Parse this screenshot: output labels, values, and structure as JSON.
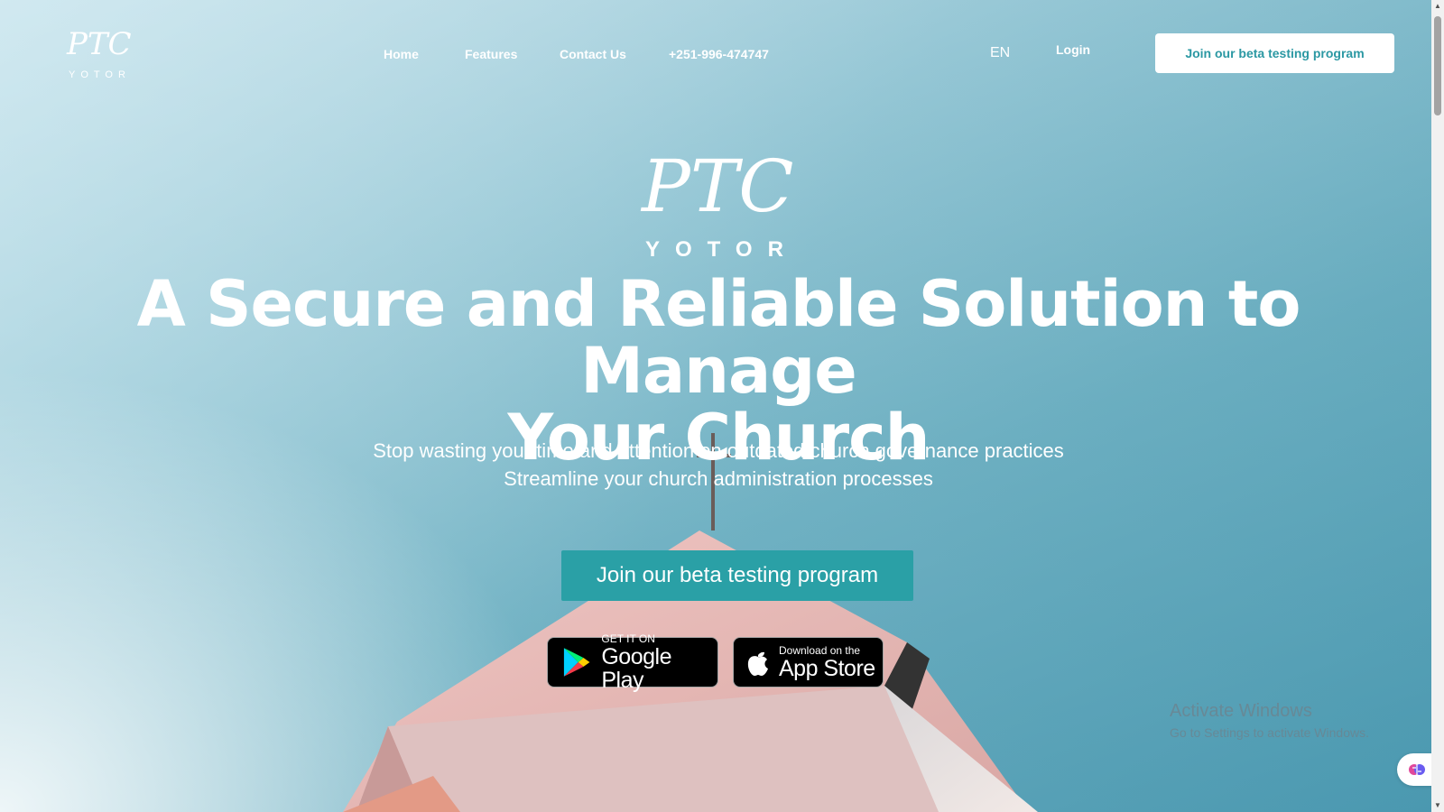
{
  "brand": {
    "logo_mark": "PTC",
    "logo_word": "YOTOR"
  },
  "nav": {
    "items": [
      {
        "label": "Home"
      },
      {
        "label": "Features"
      },
      {
        "label": "Contact Us"
      },
      {
        "label": "+251-996-474747"
      }
    ],
    "language": "EN",
    "login": "Login",
    "cta": "Join our beta testing program"
  },
  "hero": {
    "headline_line1": "A Secure and Reliable Solution to Manage",
    "headline_line2": "Your Church",
    "subtitle_line1": "Stop wasting your time and attention on outdated church governance practices",
    "subtitle_line2": "Streamline your church administration processes",
    "cta": "Join our beta testing program",
    "google_play": {
      "small": "GET IT ON",
      "big": "Google Play"
    },
    "app_store": {
      "small": "Download on the",
      "big": "App Store"
    }
  },
  "watermark": {
    "title": "Activate Windows",
    "subtitle": "Go to Settings to activate Windows."
  },
  "colors": {
    "accent": "#2aa0a6",
    "header_button_text": "#2b98a3"
  }
}
